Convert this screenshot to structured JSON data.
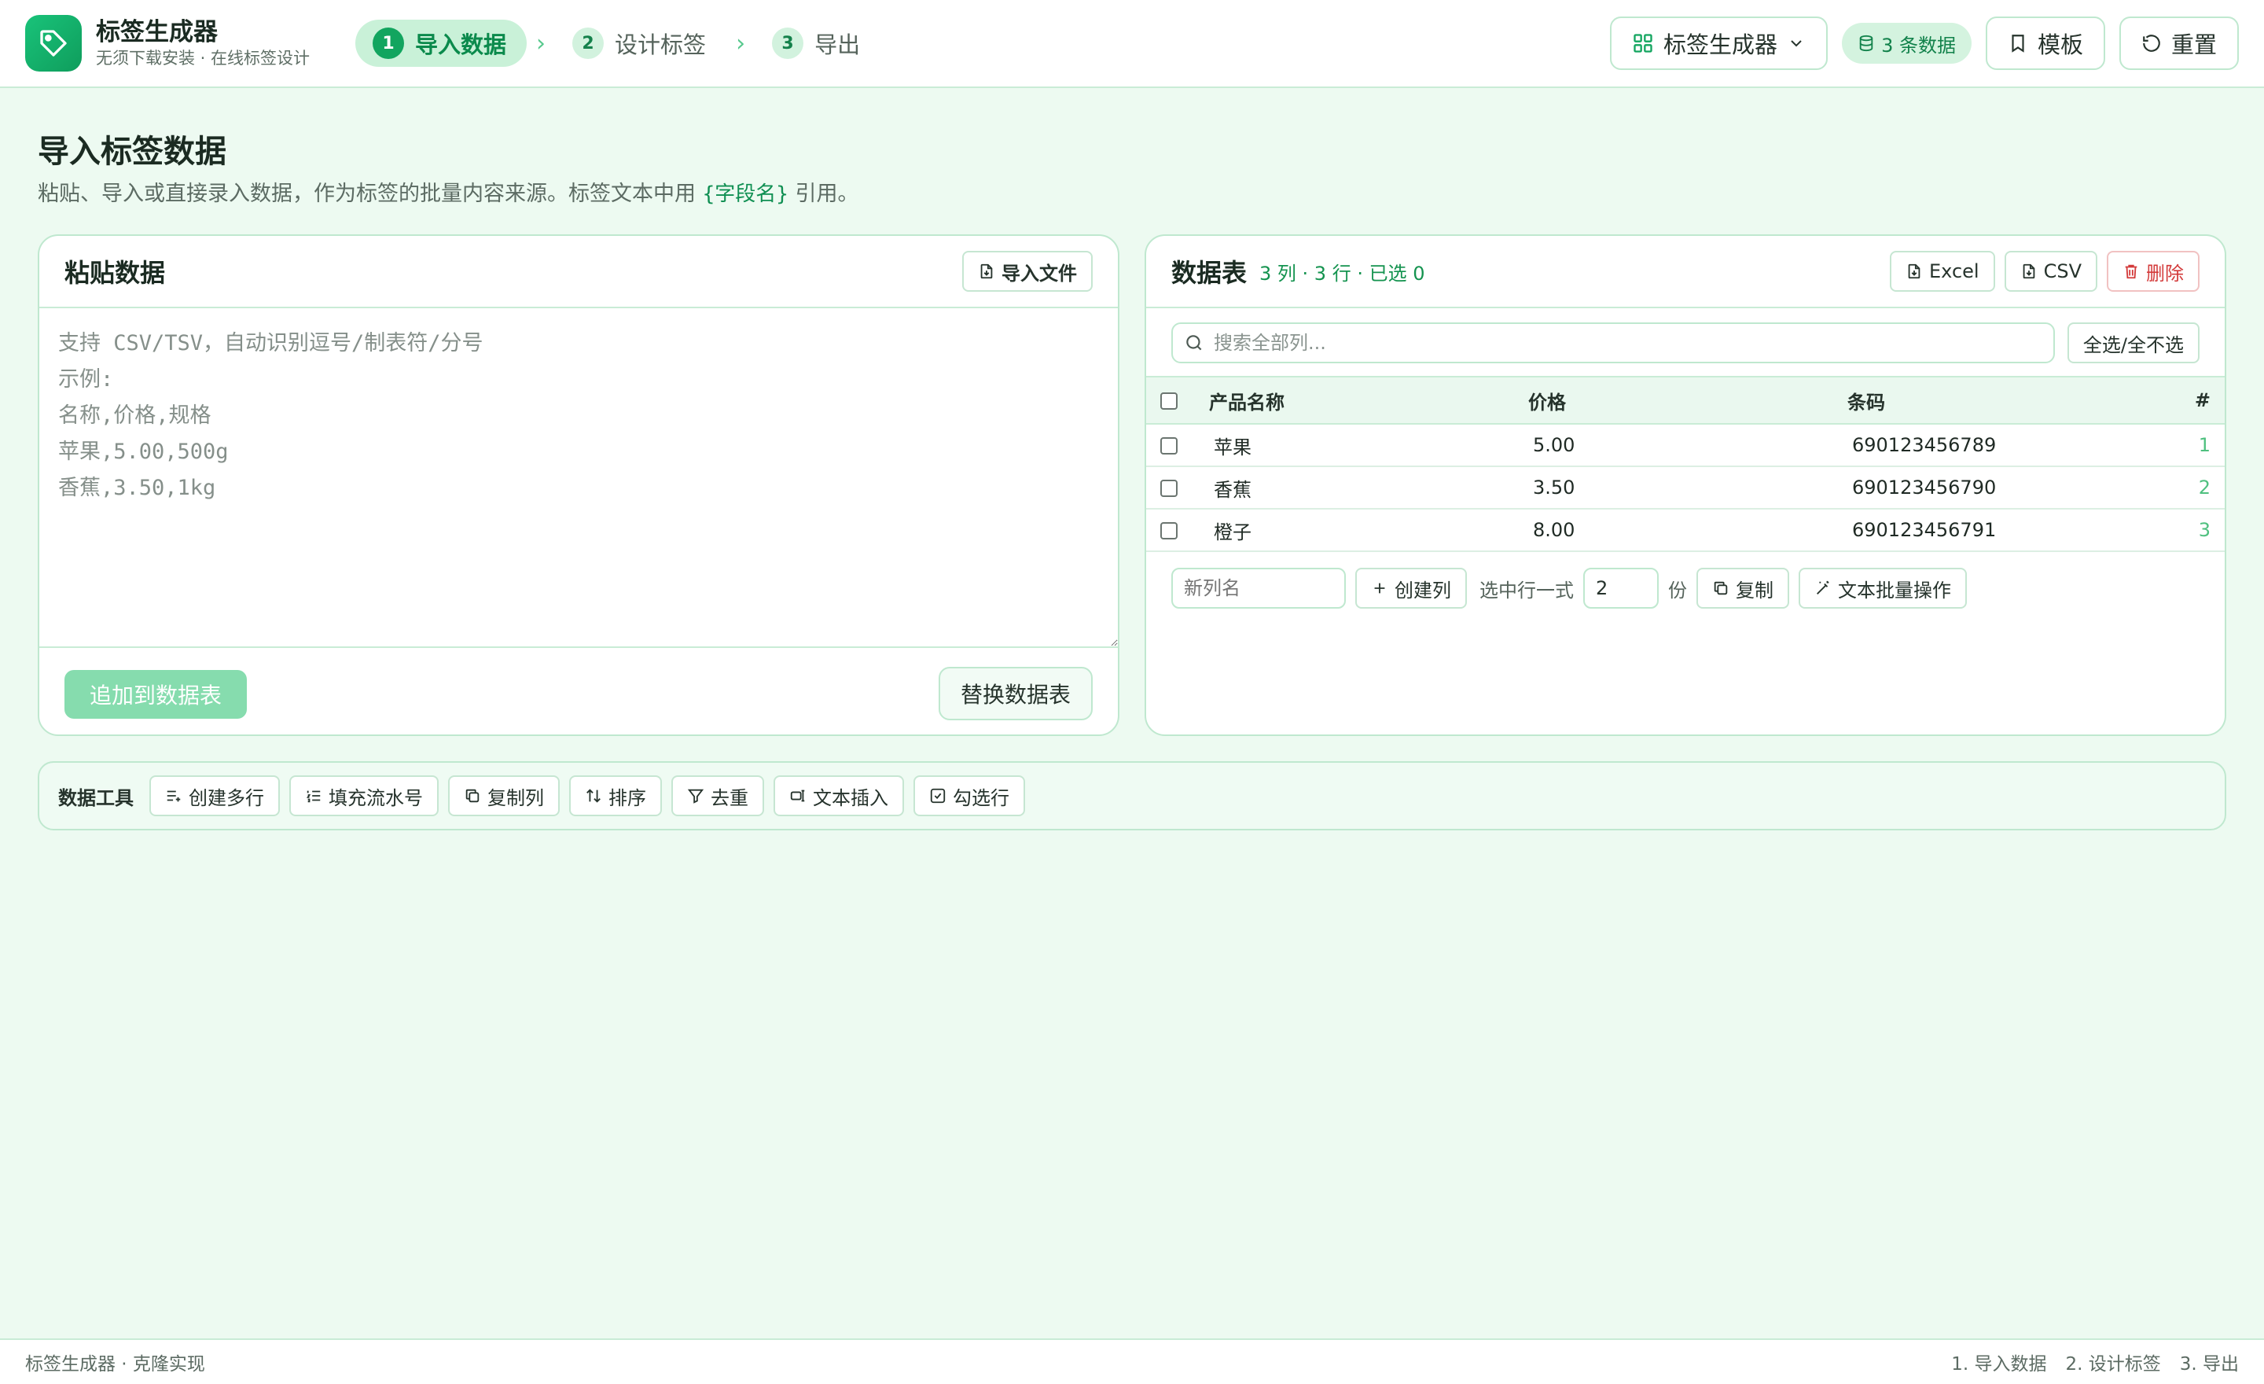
{
  "header": {
    "app_name": "标签生成器",
    "app_subtitle": "无须下载安装 · 在线标签设计",
    "steps": [
      {
        "num": "1",
        "label": "导入数据"
      },
      {
        "num": "2",
        "label": "设计标签"
      },
      {
        "num": "3",
        "label": "导出"
      }
    ],
    "app_switcher_label": "标签生成器",
    "data_badge": "3 条数据",
    "templates_label": "模板",
    "reset_label": "重置"
  },
  "page": {
    "title": "导入标签数据",
    "desc_prefix": "粘贴、导入或直接录入数据，作为标签的批量内容来源。标签文本中用",
    "desc_code": "{字段名}",
    "desc_suffix": "引用。"
  },
  "paste": {
    "title": "粘贴数据",
    "import_file_label": "导入文件",
    "placeholder": "支持 CSV/TSV，自动识别逗号/制表符/分号\n示例:\n名称,价格,规格\n苹果,5.00,500g\n香蕉,3.50,1kg",
    "append_label": "追加到数据表",
    "replace_label": "替换数据表"
  },
  "table": {
    "title": "数据表",
    "meta": "3 列 · 3 行 · 已选 0",
    "excel_label": "Excel",
    "csv_label": "CSV",
    "delete_label": "删除",
    "search_placeholder": "搜索全部列...",
    "select_all_label": "全选/全不选",
    "columns": [
      "产品名称",
      "价格",
      "条码"
    ],
    "index_header": "#",
    "rows": [
      {
        "name": "苹果",
        "price": "5.00",
        "barcode": "690123456789",
        "idx": "1"
      },
      {
        "name": "香蕉",
        "price": "3.50",
        "barcode": "690123456790",
        "idx": "2"
      },
      {
        "name": "橙子",
        "price": "8.00",
        "barcode": "690123456791",
        "idx": "3"
      }
    ],
    "new_column_placeholder": "新列名",
    "create_column_label": "创建列",
    "copies_prefix": "选中行一式",
    "copies_value": "2",
    "copies_suffix": "份",
    "copy_label": "复制",
    "batch_text_label": "文本批量操作"
  },
  "tools": {
    "label": "数据工具",
    "items": [
      "创建多行",
      "填充流水号",
      "复制列",
      "排序",
      "去重",
      "文本插入",
      "勾选行"
    ]
  },
  "footer": {
    "left": "标签生成器 · 克隆实现",
    "links": [
      "1. 导入数据",
      "2. 设计标签",
      "3. 导出"
    ]
  },
  "colors": {
    "accent": "#12a55f",
    "background": "#edfaf1",
    "danger": "#d33a3a"
  }
}
